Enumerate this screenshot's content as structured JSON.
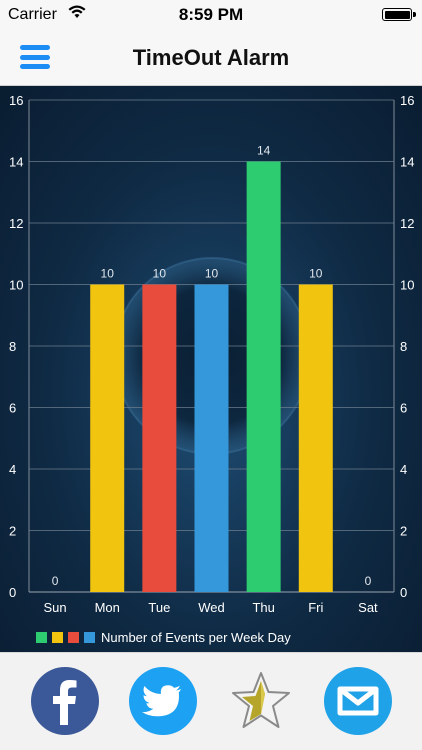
{
  "status_bar": {
    "carrier": "Carrier",
    "time": "8:59 PM"
  },
  "nav": {
    "title": "TimeOut Alarm",
    "menu_icon": "hamburger-menu-icon"
  },
  "colors": {
    "accent": "#1e8cf5",
    "yellow": "#f1c40f",
    "red": "#e74c3c",
    "blue": "#3498db",
    "green": "#2ecc71"
  },
  "chart_data": {
    "type": "bar",
    "categories": [
      "Sun",
      "Mon",
      "Tue",
      "Wed",
      "Thu",
      "Fri",
      "Sat"
    ],
    "values": [
      0,
      10,
      10,
      10,
      14,
      10,
      0
    ],
    "bar_colors": [
      "#f1c40f",
      "#f1c40f",
      "#e74c3c",
      "#3498db",
      "#2ecc71",
      "#f1c40f",
      "#f1c40f"
    ],
    "ylim": [
      0,
      16
    ],
    "yticks": [
      0,
      2,
      4,
      6,
      8,
      10,
      12,
      14,
      16
    ],
    "grid": true,
    "legend_position": "bottom-left",
    "legend": {
      "label": "Number of Events per Week Day",
      "swatches": [
        "#2ecc71",
        "#f1c40f",
        "#e74c3c",
        "#3498db"
      ]
    },
    "data_labels": true
  },
  "social": [
    {
      "name": "facebook",
      "icon": "facebook-icon"
    },
    {
      "name": "twitter",
      "icon": "twitter-icon"
    },
    {
      "name": "favorite",
      "icon": "star-icon"
    },
    {
      "name": "mailbox",
      "icon": "mailbox-icon"
    }
  ]
}
